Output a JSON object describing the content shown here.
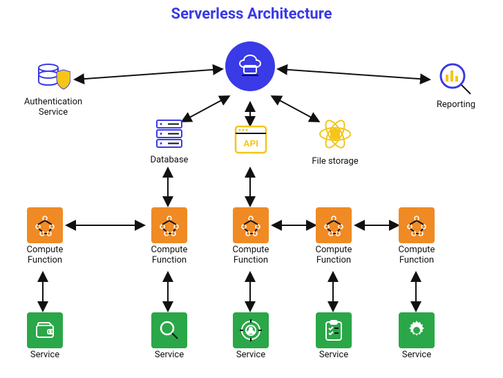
{
  "title": "Serverless Architecture",
  "colors": {
    "brand": "#3a3ae6",
    "orange": "#f08a24",
    "green": "#2aa748",
    "yellow": "#f5c518"
  },
  "hub": {
    "label": ""
  },
  "top": {
    "auth": {
      "label": "Authentication\nService"
    },
    "database": {
      "label": "Database"
    },
    "api": {
      "label": "API"
    },
    "file": {
      "label": "File storage"
    },
    "report": {
      "label": "Reporting"
    }
  },
  "compute": [
    {
      "label": "Compute\nFunction"
    },
    {
      "label": "Compute\nFunction"
    },
    {
      "label": "Compute\nFunction"
    },
    {
      "label": "Compute\nFunction"
    },
    {
      "label": "Compute\nFunction"
    }
  ],
  "services": [
    {
      "label": "Service",
      "icon": "wallet"
    },
    {
      "label": "Service",
      "icon": "search"
    },
    {
      "label": "Service",
      "icon": "target"
    },
    {
      "label": "Service",
      "icon": "checklist"
    },
    {
      "label": "Service",
      "icon": "gear"
    }
  ]
}
